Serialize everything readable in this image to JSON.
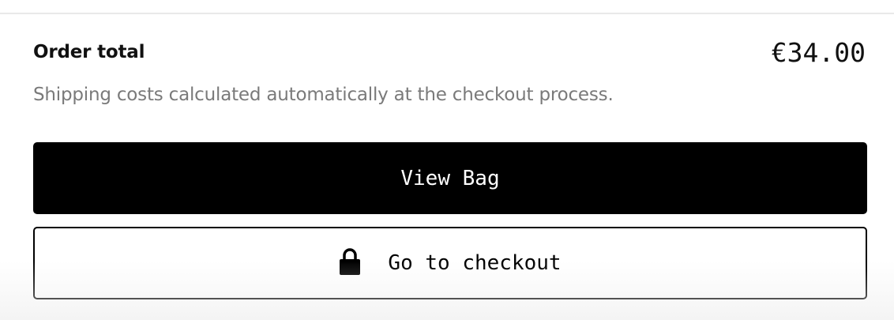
{
  "order_summary": {
    "total_label": "Order total",
    "total_value": "€34.00",
    "shipping_note": "Shipping costs calculated automatically at the checkout process."
  },
  "actions": {
    "view_bag_label": "View Bag",
    "checkout_label": "Go to checkout",
    "checkout_icon": "lock-icon"
  },
  "colors": {
    "primary_button_bg": "#000000",
    "primary_button_text": "#ffffff",
    "secondary_text": "#7a7a7a"
  }
}
